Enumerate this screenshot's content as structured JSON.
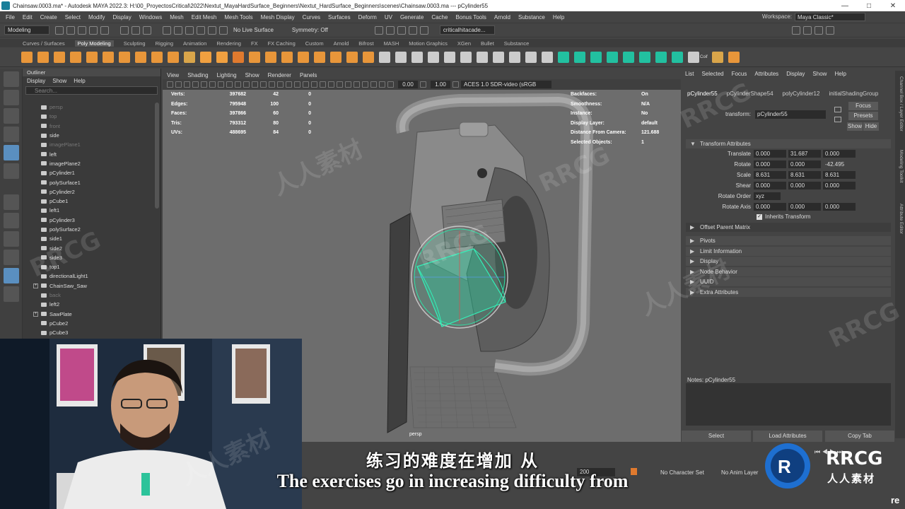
{
  "window": {
    "title": "Chainsaw.0003.ma* - Autodesk MAYA 2022.3: H:\\00_ProyectosCritical\\2022\\Nextut_MayaHardSurface_Beginners\\Nextut_HardSurface_Beginners\\scenes\\Chainsaw.0003.ma   ---   pCylinder55"
  },
  "menubar": {
    "items": [
      "File",
      "Edit",
      "Create",
      "Select",
      "Modify",
      "Display",
      "Windows",
      "Mesh",
      "Edit Mesh",
      "Mesh Tools",
      "Mesh Display",
      "Curves",
      "Surfaces",
      "Deform",
      "UV",
      "Generate",
      "Cache",
      "Bonus Tools",
      "Arnold",
      "Substance",
      "Help"
    ],
    "workspace_label": "Workspace:",
    "workspace_value": "Maya Classic*"
  },
  "statusline": {
    "mode": "Modeling",
    "live_surface": "No Live Surface",
    "symmetry": "Symmetry: Off",
    "project": "criticalhitacade..."
  },
  "shelf": {
    "tabs": [
      "Curves / Surfaces",
      "Poly Modeling",
      "Sculpting",
      "Rigging",
      "Animation",
      "Rendering",
      "FX",
      "FX Caching",
      "Custom",
      "Arnold",
      "Bifrost",
      "MASH",
      "Motion Graphics",
      "XGen",
      "Bullet",
      "Substance"
    ],
    "active_tab": "Poly Modeling",
    "icon_colors": [
      "#e8963a",
      "#e8963a",
      "#e8963a",
      "#e8963a",
      "#e8963a",
      "#e8963a",
      "#e8963a",
      "#e8963a",
      "#e8963a",
      "#e8963a",
      "#d9a54a",
      "#f0a040",
      "#f0a040",
      "#e07a2e",
      "#e8963a",
      "#e8963a",
      "#e8963a",
      "#e8963a",
      "#e8963a",
      "#e8963a",
      "#e8963a",
      "#e8963a",
      "#cccccc",
      "#cccccc",
      "#cccccc",
      "#cccccc",
      "#cccccc",
      "#cccccc",
      "#cccccc",
      "#cccccc",
      "#cccccc",
      "#cccccc",
      "#cccccc",
      "#22c0a0",
      "#22c0a0",
      "#22c0a0",
      "#22c0a0",
      "#22c0a0",
      "#22c0a0",
      "#22c0a0",
      "#22c0a0",
      "#cccccc",
      "#d9a54a",
      "#e8963a"
    ],
    "coif_label": "Coif"
  },
  "outliner": {
    "title": "Outliner",
    "menu": [
      "Display",
      "Show",
      "Help"
    ],
    "search_placeholder": "Search...",
    "items": [
      {
        "label": "persp",
        "dim": true,
        "expand": ""
      },
      {
        "label": "top",
        "dim": true,
        "expand": ""
      },
      {
        "label": "front",
        "dim": true,
        "expand": ""
      },
      {
        "label": "side",
        "dim": false,
        "expand": ""
      },
      {
        "label": "imagePlane1",
        "dim": true,
        "expand": ""
      },
      {
        "label": "left",
        "dim": false,
        "expand": ""
      },
      {
        "label": "imagePlane2",
        "dim": false,
        "expand": ""
      },
      {
        "label": "pCylinder1",
        "dim": false,
        "expand": ""
      },
      {
        "label": "polySurface1",
        "dim": false,
        "expand": ""
      },
      {
        "label": "pCylinder2",
        "dim": false,
        "expand": ""
      },
      {
        "label": "pCube1",
        "dim": false,
        "expand": ""
      },
      {
        "label": "left1",
        "dim": false,
        "expand": ""
      },
      {
        "label": "pCylinder3",
        "dim": false,
        "expand": ""
      },
      {
        "label": "polySurface2",
        "dim": false,
        "expand": ""
      },
      {
        "label": "side1",
        "dim": false,
        "expand": ""
      },
      {
        "label": "side2",
        "dim": false,
        "expand": ""
      },
      {
        "label": "side3",
        "dim": false,
        "expand": ""
      },
      {
        "label": "top1",
        "dim": false,
        "expand": ""
      },
      {
        "label": "directionalLight1",
        "dim": false,
        "expand": ""
      },
      {
        "label": "ChainSaw_Saw",
        "dim": false,
        "expand": "+"
      },
      {
        "label": "back",
        "dim": true,
        "expand": ""
      },
      {
        "label": "left2",
        "dim": false,
        "expand": ""
      },
      {
        "label": "SawPlate",
        "dim": false,
        "expand": "+"
      },
      {
        "label": "pCube2",
        "dim": false,
        "expand": ""
      },
      {
        "label": "pCube3",
        "dim": false,
        "expand": ""
      }
    ]
  },
  "viewport": {
    "menu": [
      "View",
      "Shading",
      "Lighting",
      "Show",
      "Renderer",
      "Panels"
    ],
    "exposure": "0.00",
    "gamma": "1.00",
    "color_space": "ACES 1.0 SDR-video (sRGB",
    "camera": "persp",
    "hud_left": [
      {
        "k": "Verts:",
        "v1": "397682",
        "v2": "42",
        "v3": "0"
      },
      {
        "k": "Edges:",
        "v1": "795948",
        "v2": "100",
        "v3": "0"
      },
      {
        "k": "Faces:",
        "v1": "397866",
        "v2": "60",
        "v3": "0"
      },
      {
        "k": "Tris:",
        "v1": "793312",
        "v2": "80",
        "v3": "0"
      },
      {
        "k": "UVs:",
        "v1": "488695",
        "v2": "84",
        "v3": "0"
      }
    ],
    "hud_right": [
      {
        "k": "Backfaces:",
        "v": "On"
      },
      {
        "k": "Smoothness:",
        "v": "N/A"
      },
      {
        "k": "Instance:",
        "v": "No"
      },
      {
        "k": "Display Layer:",
        "v": "default"
      },
      {
        "k": "Distance From Camera:",
        "v": "121.688"
      },
      {
        "k": "Selected Objects:",
        "v": "1"
      }
    ]
  },
  "attribute_editor": {
    "menu": [
      "List",
      "Selected",
      "Focus",
      "Attributes",
      "Display",
      "Show",
      "Help"
    ],
    "tabs": [
      "pCylinder55",
      "pCylinderShape54",
      "polyCylinder12",
      "initialShadingGroup"
    ],
    "transform_label": "transform:",
    "transform_value": "pCylinder55",
    "buttons": {
      "focus": "Focus",
      "presets": "Presets",
      "show": "Show",
      "hide": "Hide"
    },
    "section_transform": "Transform Attributes",
    "rows": [
      {
        "label": "Translate",
        "values": [
          "0.000",
          "31.687",
          "0.000"
        ]
      },
      {
        "label": "Rotate",
        "values": [
          "0.000",
          "0.000",
          "-42.495"
        ]
      },
      {
        "label": "Scale",
        "values": [
          "8.631",
          "8.631",
          "8.631"
        ]
      },
      {
        "label": "Shear",
        "values": [
          "0.000",
          "0.000",
          "0.000"
        ]
      }
    ],
    "rotate_order_label": "Rotate Order",
    "rotate_order_value": "xyz",
    "rotate_axis_label": "Rotate Axis",
    "rotate_axis_values": [
      "0.000",
      "0.000",
      "0.000"
    ],
    "inherits_transform": "Inherits Transform",
    "offset_parent_matrix": "Offset Parent Matrix",
    "sections": [
      "Pivots",
      "Limit Information",
      "Display",
      "Node Behavior",
      "UUID",
      "Extra Attributes"
    ],
    "notes_label": "Notes: pCylinder55",
    "bottom_buttons": [
      "Select",
      "Load Attributes",
      "Copy Tab"
    ]
  },
  "side_tabs": [
    "Channel Box / Layer Editor",
    "Modeling Toolkit",
    "Attribute Editor"
  ],
  "timebar": {
    "end_frame": "200",
    "character_set": "No Character Set",
    "anim_layer": "No Anim Layer"
  },
  "subtitles": {
    "chinese": "练习的难度在增加 从",
    "english": "The exercises go in increasing difficulty from"
  },
  "watermarks": [
    "RRCG",
    "人人素材"
  ],
  "logo": {
    "text": "RRCG",
    "sub": "人人素材"
  },
  "corner_text": "re"
}
